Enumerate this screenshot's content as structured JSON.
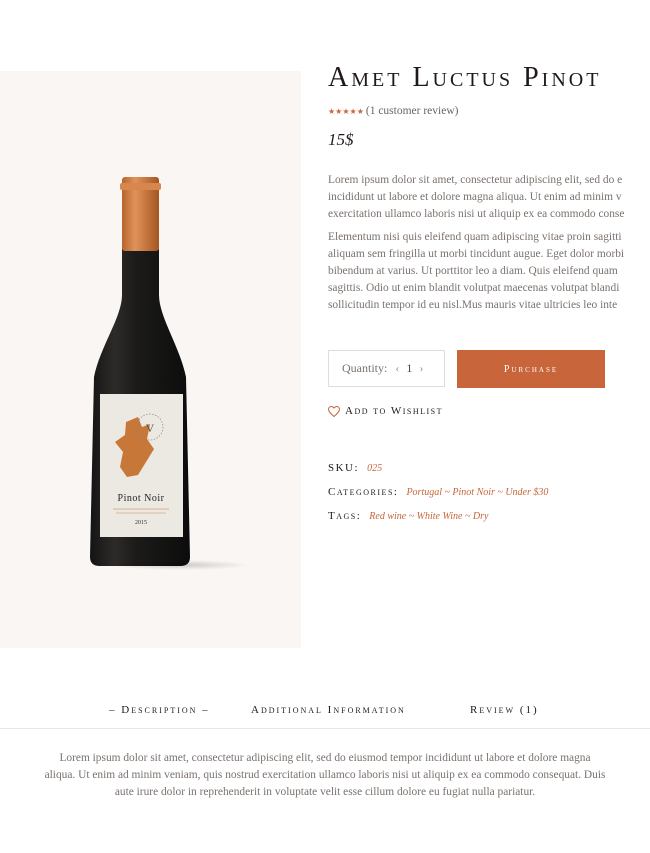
{
  "product": {
    "title": "Amet Luctus Pinot",
    "rating_text": "(1 customer review)",
    "rating_stars": 5,
    "price": "15$",
    "description_paragraph_1": [
      "Lorem ipsum dolor sit amet, consectetur adipiscing elit, sed do e",
      "incididunt ut labore et dolore magna aliqua. Ut enim ad minim v",
      "exercitation ullamco laboris nisi ut aliquip ex ea commodo conse"
    ],
    "description_paragraph_2": [
      "Elementum nisi quis eleifend quam adipiscing vitae proin sagitti",
      "aliquam sem fringilla ut morbi tincidunt augue. Eget dolor morbi",
      "bibendum at varius. Ut porttitor leo a diam. Quis eleifend quam",
      "sagittis. Odio ut enim blandit volutpat maecenas volutpat blandi",
      "sollicitudin tempor id eu nisl.Mus mauris vitae ultricies leo inte"
    ],
    "label_name": "Pinot Noir",
    "label_year": "2015"
  },
  "cart": {
    "quantity_label": "Quantity:",
    "quantity_value": "1",
    "decrease_glyph": "‹",
    "increase_glyph": "›",
    "purchase_label": "Purchase"
  },
  "wishlist": {
    "label": "Add to Wishlist"
  },
  "meta": {
    "sku_label": "SKU:",
    "sku_value": "025",
    "categories_label": "Categories:",
    "categories_value": "Portugal ~ Pinot Noir ~  Under $30",
    "tags_label": "Tags:",
    "tags_value": "Red wine ~ White Wine ~ Dry"
  },
  "tabs": {
    "description": "– Description –",
    "additional": "Additional Information",
    "review": "Review (1)"
  },
  "bottom_description": [
    "Lorem ipsum dolor sit amet, consectetur adipiscing elit, sed do eiusmod tempor incididunt ut labore et dolore magna",
    "aliqua. Ut enim ad minim veniam, quis nostrud exercitation ullamco laboris nisi ut aliquip ex ea commodo consequat. Duis",
    "aute irure dolor in reprehenderit in voluptate velit esse cillum dolore eu fugiat nulla pariatur."
  ],
  "colors": {
    "accent": "#c9653a",
    "heading": "#1f1a17",
    "body_text": "#7a726d",
    "image_background": "#f9f6f4"
  },
  "icons": {
    "star": "star-icon",
    "heart": "heart-icon"
  }
}
